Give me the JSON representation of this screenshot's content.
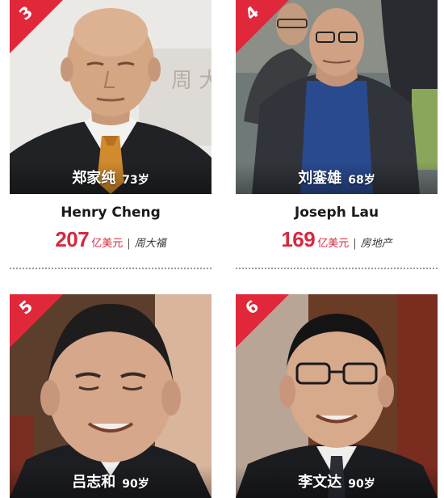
{
  "cards": [
    {
      "rank": "3",
      "name_cn": "郑家纯",
      "age": "73岁",
      "name_en": "Henry Cheng",
      "wealth_value": "207",
      "wealth_unit": "亿美元",
      "separator": "|",
      "company": "周大福",
      "bg_text": "周 大"
    },
    {
      "rank": "4",
      "name_cn": "刘銮雄",
      "age": "68岁",
      "name_en": "Joseph Lau",
      "wealth_value": "169",
      "wealth_unit": "亿美元",
      "separator": "|",
      "company": "房地产"
    },
    {
      "rank": "5",
      "name_cn": "吕志和",
      "age": "90岁"
    },
    {
      "rank": "6",
      "name_cn": "李文达",
      "age": "90岁"
    }
  ],
  "colors": {
    "accent_red": "#d8283e",
    "badge_red": "#e1273a"
  }
}
